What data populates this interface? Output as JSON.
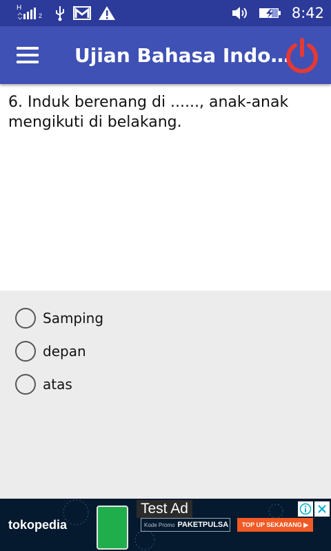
{
  "status_bar": {
    "network_label": "H",
    "sim_label": "2",
    "icons": [
      "signal-icon",
      "usb-icon",
      "gmail-icon",
      "warning-icon",
      "volume-icon",
      "battery-charging-icon"
    ],
    "time": "8:42"
  },
  "app_bar": {
    "title": "Ujian Bahasa Indo…",
    "menu_icon": "hamburger-menu-icon",
    "power_icon": "power-icon",
    "power_color": "#e53935"
  },
  "question": {
    "text": "6. Induk berenang di ......, anak-anak mengikuti di belakang."
  },
  "options": [
    {
      "label": "Samping",
      "selected": false
    },
    {
      "label": "depan",
      "selected": false
    },
    {
      "label": "atas",
      "selected": false
    }
  ],
  "ad": {
    "brand": "tokopedia",
    "badge": "Test Ad",
    "promo_prefix": "Kode Promo",
    "promo_code": "PAKETPULSA",
    "cta": "TOP UP SEKARANG ▶",
    "cta_color": "#f15a24",
    "info_icon": "ad-info-icon",
    "close_icon": "close-icon"
  },
  "colors": {
    "status_bar": "#2c3a9a",
    "app_bar": "#3f51b5",
    "options_bg": "#ececec"
  }
}
